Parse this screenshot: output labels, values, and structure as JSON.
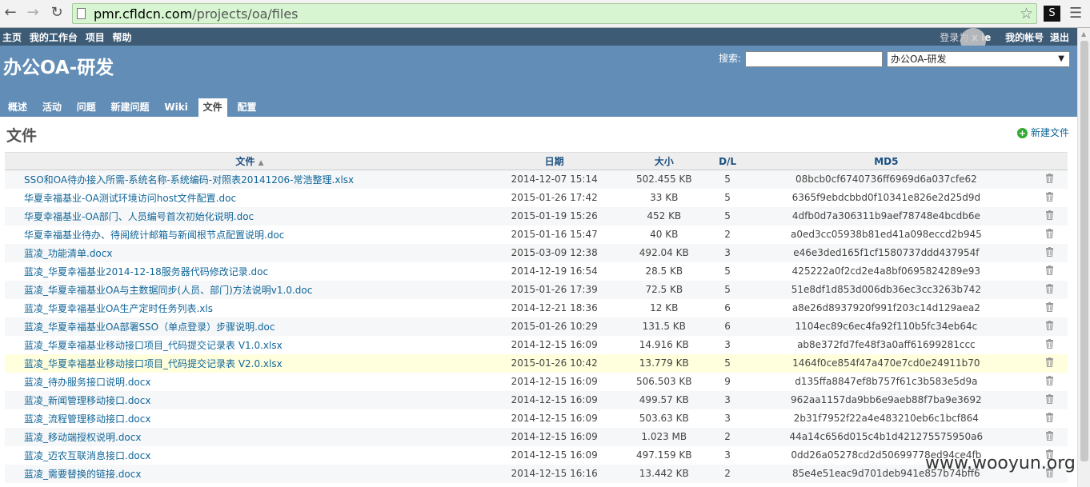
{
  "browser": {
    "url_host": "pmr.cfldcn.com",
    "url_path": "/projects/oa/files",
    "extension_label": "S"
  },
  "top_menu": {
    "left": [
      "主页",
      "我的工作台",
      "项目",
      "帮助"
    ],
    "login_prefix": "登录为",
    "login_user": "x      ie",
    "my_account": "我的帐号",
    "logout": "退出"
  },
  "header": {
    "project_title": "办公OA-研发",
    "search_label": "搜索:",
    "project_select": "办公OA-研发"
  },
  "tabs": [
    "概述",
    "活动",
    "问题",
    "新建问题",
    "Wiki",
    "文件",
    "配置"
  ],
  "selected_tab": "文件",
  "page": {
    "title": "文件",
    "new_file": "新建文件"
  },
  "table": {
    "headers": {
      "name": "文件",
      "name_sort": "▲",
      "date": "日期",
      "size": "大小",
      "dl": "D/L",
      "md5": "MD5"
    },
    "rows": [
      {
        "name": "SSO和OA待办接入所需-系统名称-系统编码-对照表20141206-常浩整理.xlsx",
        "date": "2014-12-07 15:14",
        "size": "502.455 KB",
        "dl": "5",
        "md5": "08bcb0cf6740736ff6969d6a037cfe62"
      },
      {
        "name": "华夏幸福基业-OA测试环境访问host文件配置.doc",
        "date": "2015-01-26 17:42",
        "size": "33 KB",
        "dl": "5",
        "md5": "6365f9ebdcbbd0f10341e826e2d25d9d"
      },
      {
        "name": "华夏幸福基业-OA部门、人员编号首次初始化说明.doc",
        "date": "2015-01-19 15:26",
        "size": "452 KB",
        "dl": "5",
        "md5": "4dfb0d7a306311b9aef78748e4bcdb6e"
      },
      {
        "name": "华夏幸福基业待办、待阅统计邮箱与新闻根节点配置说明.doc",
        "date": "2015-01-16 15:47",
        "size": "40 KB",
        "dl": "2",
        "md5": "a0ed3cc05938b81ed41a098eccd2b945"
      },
      {
        "name": "蓝凌_功能清单.docx",
        "date": "2015-03-09 12:38",
        "size": "492.04 KB",
        "dl": "3",
        "md5": "e46e3ded165f1cf1580737ddd437954f"
      },
      {
        "name": "蓝凌_华夏幸福基业2014-12-18服务器代码修改记录.doc",
        "date": "2014-12-19 16:54",
        "size": "28.5 KB",
        "dl": "5",
        "md5": "425222a0f2cd2e4a8bf0695824289e93"
      },
      {
        "name": "蓝凌_华夏幸福基业OA与主数据同步(人员、部门)方法说明v1.0.doc",
        "date": "2015-01-26 17:39",
        "size": "72.5 KB",
        "dl": "5",
        "md5": "51e8df1d853d006db36ec3cc3263b742"
      },
      {
        "name": "蓝凌_华夏幸福基业OA生产定时任务列表.xls",
        "date": "2014-12-21 18:36",
        "size": "12 KB",
        "dl": "6",
        "md5": "a8e26d8937920f991f203c14d129aea2"
      },
      {
        "name": "蓝凌_华夏幸福基业OA部署SSO（单点登录）步骤说明.doc",
        "date": "2015-01-26 10:29",
        "size": "131.5 KB",
        "dl": "6",
        "md5": "1104ec89c6ec4fa92f110b5fc34eb64c"
      },
      {
        "name": "蓝凌_华夏幸福基业移动接口项目_代码提交记录表 V1.0.xlsx",
        "date": "2014-12-15 16:09",
        "size": "14.916 KB",
        "dl": "3",
        "md5": "ab8e372fd7fe48f3a0aff61699281ccc"
      },
      {
        "name": "蓝凌_华夏幸福基业移动接口项目_代码提交记录表 V2.0.xlsx",
        "date": "2015-01-26 10:42",
        "size": "13.779 KB",
        "dl": "5",
        "md5": "1464f0ce854f47a470e7cd0e24911b70"
      },
      {
        "name": "蓝凌_待办服务接口说明.docx",
        "date": "2014-12-15 16:09",
        "size": "506.503 KB",
        "dl": "9",
        "md5": "d135ffa8847ef8b757f61c3b583e5d9a"
      },
      {
        "name": "蓝凌_新闻管理移动接口.docx",
        "date": "2014-12-15 16:09",
        "size": "499.57 KB",
        "dl": "3",
        "md5": "962aa1157da9bb6e9aeb88f7ba9e3692"
      },
      {
        "name": "蓝凌_流程管理移动接口.docx",
        "date": "2014-12-15 16:09",
        "size": "503.63 KB",
        "dl": "3",
        "md5": "2b31f7952f22a4e483210eb6c1bcf864"
      },
      {
        "name": "蓝凌_移动端授权说明.docx",
        "date": "2014-12-15 16:09",
        "size": "1.023 MB",
        "dl": "2",
        "md5": "44a14c656d015c4b1d421275575950a6"
      },
      {
        "name": "蓝凌_迈农互联消息接口.docx",
        "date": "2014-12-15 16:09",
        "size": "497.159 KB",
        "dl": "3",
        "md5": "0dd26a05278cd2d50699778ed94ce4fb"
      },
      {
        "name": "蓝凌_需要替换的链接.docx",
        "date": "2014-12-15 16:16",
        "size": "13.442 KB",
        "dl": "2",
        "md5": "85e4e51eac9d701deb941e857b74bff6"
      }
    ],
    "highlighted_row": 10
  },
  "watermark": "www.wooyun.org"
}
